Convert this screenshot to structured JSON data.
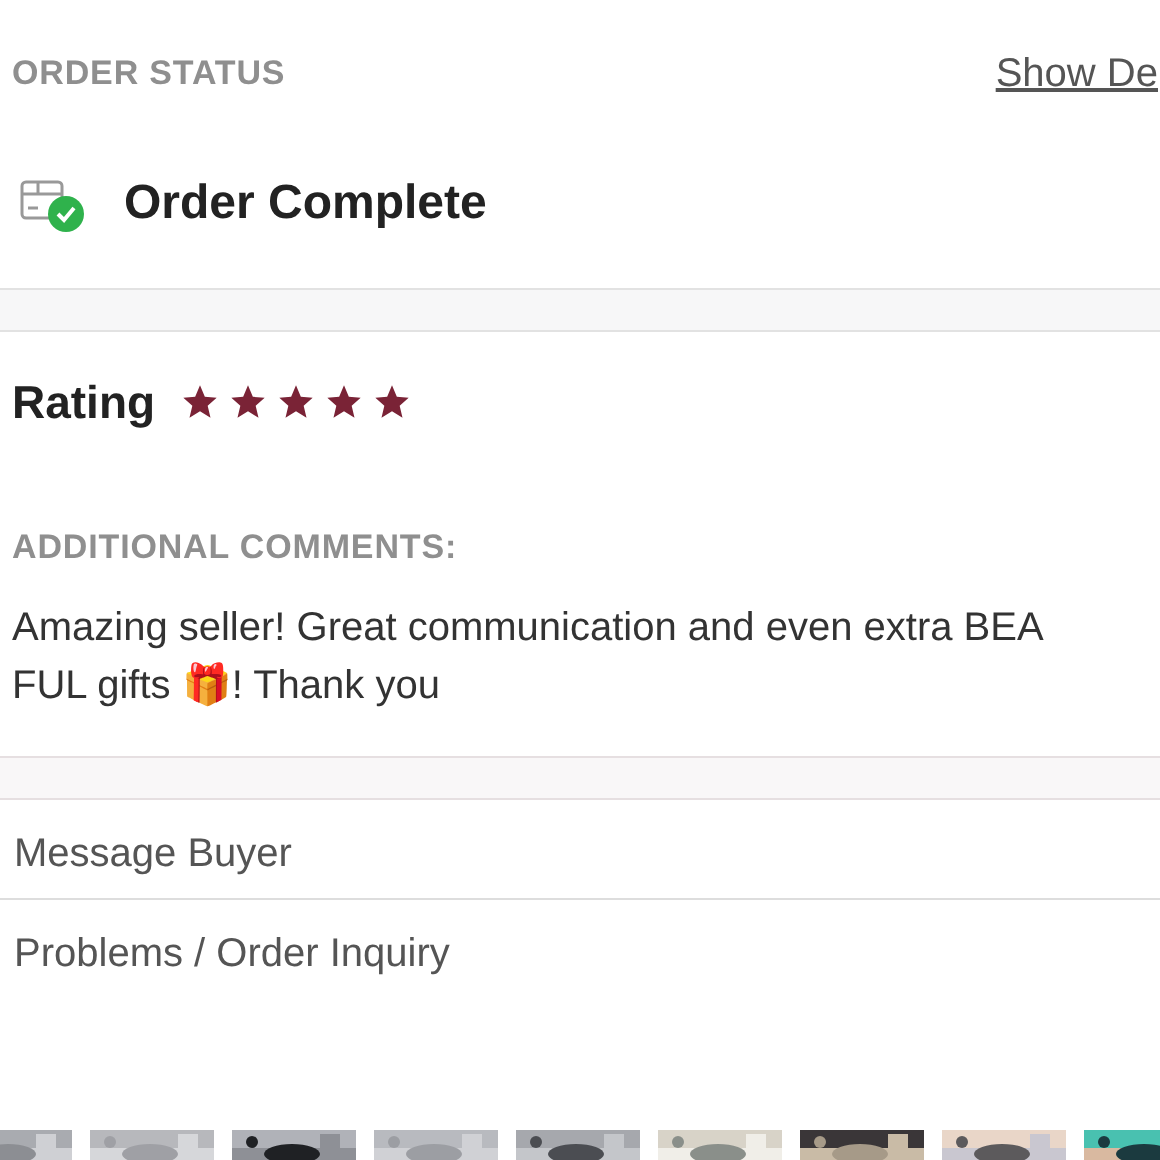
{
  "order_status": {
    "heading": "ORDER STATUS",
    "details_link": "Show De",
    "status": "Order Complete"
  },
  "rating": {
    "label": "Rating",
    "stars": 5
  },
  "comments": {
    "heading": "ADDITIONAL COMMENTS:",
    "lines": [
      "Amazing seller! Great communication and even extra BEA",
      "FUL gifts 🎁! Thank you"
    ]
  },
  "actions": [
    {
      "label": "Message Buyer"
    },
    {
      "label": "Problems / Order Inquiry"
    }
  ]
}
